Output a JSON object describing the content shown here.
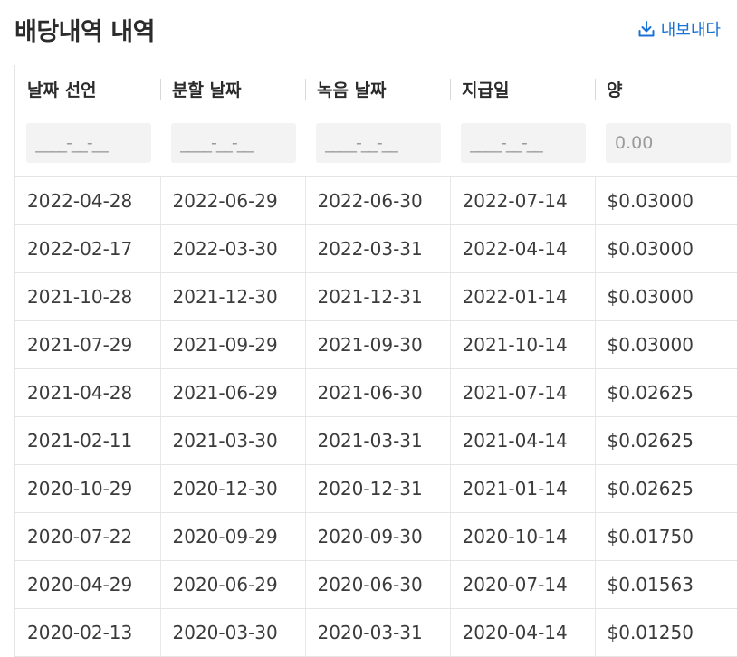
{
  "header": {
    "title": "배당내역 내역",
    "export_label": "내보내다"
  },
  "table": {
    "columns": [
      {
        "label": "날짜 선언",
        "filter_placeholder": "____-__-__"
      },
      {
        "label": "분할 날짜",
        "filter_placeholder": "____-__-__"
      },
      {
        "label": "녹음 날짜",
        "filter_placeholder": "____-__-__"
      },
      {
        "label": "지급일",
        "filter_placeholder": "____-__-__"
      },
      {
        "label": "양",
        "filter_placeholder": "0.00"
      }
    ],
    "rows": [
      [
        "2022-04-28",
        "2022-06-29",
        "2022-06-30",
        "2022-07-14",
        "$0.03000"
      ],
      [
        "2022-02-17",
        "2022-03-30",
        "2022-03-31",
        "2022-04-14",
        "$0.03000"
      ],
      [
        "2021-10-28",
        "2021-12-30",
        "2021-12-31",
        "2022-01-14",
        "$0.03000"
      ],
      [
        "2021-07-29",
        "2021-09-29",
        "2021-09-30",
        "2021-10-14",
        "$0.03000"
      ],
      [
        "2021-04-28",
        "2021-06-29",
        "2021-06-30",
        "2021-07-14",
        "$0.02625"
      ],
      [
        "2021-02-11",
        "2021-03-30",
        "2021-03-31",
        "2021-04-14",
        "$0.02625"
      ],
      [
        "2020-10-29",
        "2020-12-30",
        "2020-12-31",
        "2021-01-14",
        "$0.02625"
      ],
      [
        "2020-07-22",
        "2020-09-29",
        "2020-09-30",
        "2020-10-14",
        "$0.01750"
      ],
      [
        "2020-04-29",
        "2020-06-29",
        "2020-06-30",
        "2020-07-14",
        "$0.01563"
      ],
      [
        "2020-02-13",
        "2020-03-30",
        "2020-03-31",
        "2020-04-14",
        "$0.01250"
      ]
    ]
  },
  "icons": {
    "export": "download-icon"
  },
  "colors": {
    "accent": "#1a73d4",
    "border": "#e4e4e4",
    "filter_bg": "#f3f3f3"
  }
}
